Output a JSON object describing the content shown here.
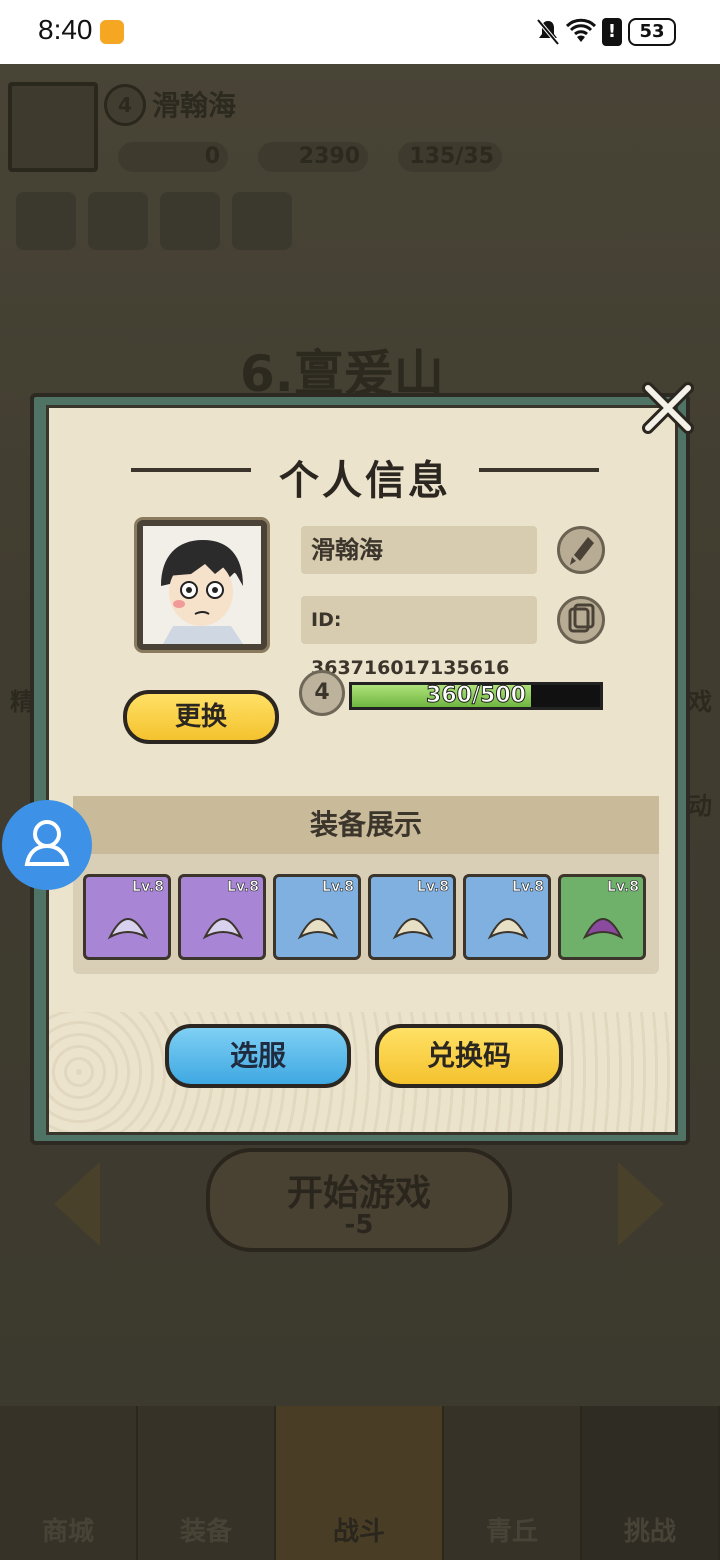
{
  "status_bar": {
    "time": "8:40",
    "battery": "53"
  },
  "player_header": {
    "level": "4",
    "name": "滑翰海",
    "coins": "0",
    "gems": "2390",
    "stamina": "135/35"
  },
  "stage": {
    "title": "6.亶爰山",
    "start_label": "开始游戏",
    "cost": "-5"
  },
  "dialog": {
    "title": "个人信息",
    "name": "滑翰海",
    "id_text": "ID: 363716017135616",
    "level": "4",
    "xp_text": "360/500",
    "xp_progress": 0.72,
    "change_label": "更换",
    "equip_title": "装备展示",
    "equipment": [
      {
        "level": "Lv.8",
        "rarity": "purple",
        "icon": "bow-icon"
      },
      {
        "level": "Lv.8",
        "rarity": "purple",
        "icon": "helmet-icon"
      },
      {
        "level": "Lv.8",
        "rarity": "blue",
        "icon": "armor-icon"
      },
      {
        "level": "Lv.8",
        "rarity": "blue",
        "icon": "belt-icon"
      },
      {
        "level": "Lv.8",
        "rarity": "blue",
        "icon": "boots-icon"
      },
      {
        "level": "Lv.8",
        "rarity": "green",
        "icon": "amulet-icon"
      }
    ],
    "server_label": "选服",
    "redeem_label": "兑换码"
  },
  "side_labels": {
    "left": "精",
    "right": "戏",
    "right2": "动"
  },
  "bottom_nav": [
    "商城",
    "装备",
    "战斗",
    "青丘",
    "挑战"
  ],
  "colors": {
    "accent_yellow": "#f4c22e",
    "accent_blue": "#3fa8e2",
    "dialog_frame": "#4f7364",
    "paper": "#ece3cd"
  }
}
